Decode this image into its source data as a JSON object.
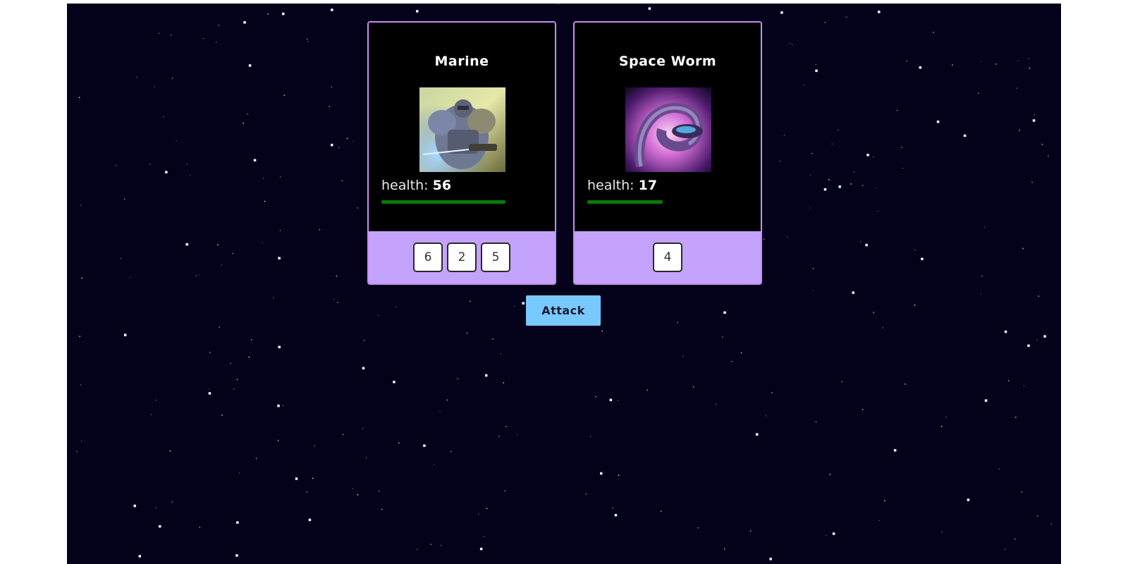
{
  "cards": [
    {
      "name": "Marine",
      "health_label": "health:",
      "health": 56,
      "health_fraction": 0.84,
      "portrait_icon": "armored-marine-portrait",
      "dice": [
        "6",
        "2",
        "5"
      ]
    },
    {
      "name": "Space Worm",
      "health_label": "health:",
      "health": 17,
      "health_fraction": 0.51,
      "portrait_icon": "space-worm-portrait",
      "dice": [
        "4"
      ]
    }
  ],
  "attack_button": {
    "label": "Attack"
  },
  "colors": {
    "background": "#03021a",
    "card_border": "#c98bf0",
    "card_bottom": "#c3a3fb",
    "health_bar": "#0a7a0a",
    "button": "#78c9ff"
  }
}
